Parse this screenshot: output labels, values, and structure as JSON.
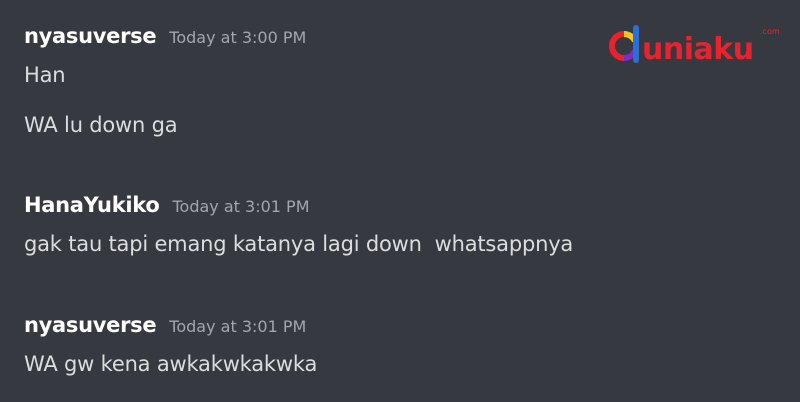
{
  "messages": [
    {
      "author": "nyasuverse",
      "timestamp": "Today at 3:00 PM",
      "lines": [
        "Han",
        "WA lu down ga"
      ]
    },
    {
      "author": "HanaYukiko",
      "timestamp": "Today at 3:01 PM",
      "lines": [
        "gak tau tapi emang katanya lagi down  whatsappnya"
      ]
    },
    {
      "author": "nyasuverse",
      "timestamp": "Today at 3:01 PM",
      "lines": [
        "WA gw kena awkakwkakwka"
      ]
    }
  ],
  "watermark": {
    "brand": "duniaku",
    "suffix": ".com"
  },
  "colors": {
    "background": "#36393f",
    "username": "#ffffff",
    "message_text": "#dcddde",
    "timestamp": "#a3a6aa",
    "logo_red": "#e8232f",
    "logo_blue": "#2b6fd6",
    "logo_yellow": "#f6c324",
    "logo_purple": "#7b2fbf"
  }
}
